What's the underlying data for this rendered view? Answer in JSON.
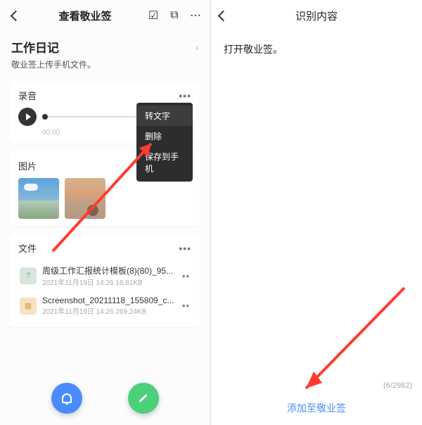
{
  "left": {
    "topbar": {
      "title": "查看敬业签"
    },
    "heading": "工作日记",
    "subheading": "敬业签上传手机文件。",
    "audio_card": {
      "title": "录音",
      "time": "00:00",
      "popup": {
        "to_text": "转文字",
        "delete": "删除",
        "save": "保存到手机"
      }
    },
    "image_card": {
      "title": "图片"
    },
    "file_card": {
      "title": "文件",
      "files": [
        {
          "name": "周级工作汇报统计模板(8)(80)_95...",
          "meta": "2021年11月19日 14:26 16.81KB"
        },
        {
          "name": "Screenshot_20211118_155809_c...",
          "meta": "2021年11月19日 14:26 269.24KB"
        }
      ]
    }
  },
  "right": {
    "topbar": {
      "title": "识别内容"
    },
    "body_text": "打开敬业签。",
    "counter": "(6/2982)",
    "action": "添加至敬业签"
  }
}
